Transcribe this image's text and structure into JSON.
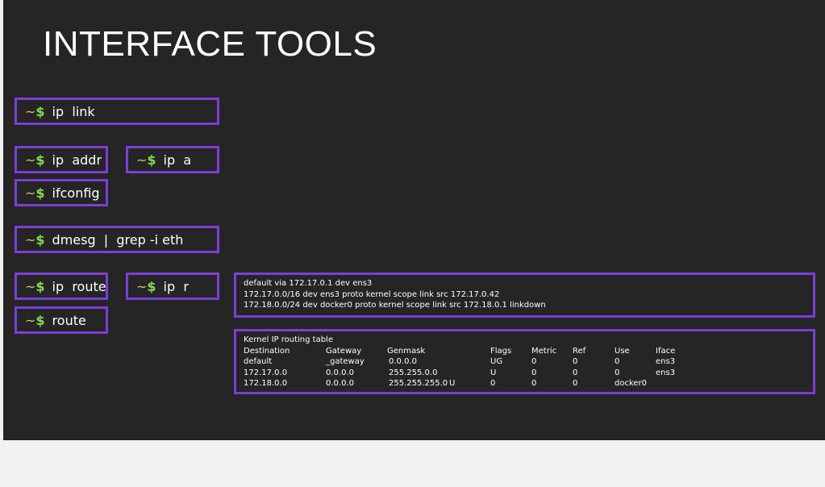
{
  "title": "INTERFACE TOOLS",
  "prompt": {
    "tilde": "~",
    "dollar": "$"
  },
  "commands": {
    "ip_link": "ip  link",
    "ip_addr": "ip  addr",
    "ip_a": "ip  a",
    "ifconfig": "ifconfig",
    "dmesg": "dmesg  |  grep -i eth",
    "ip_route": "ip  route",
    "ip_r": "ip  r",
    "route": "route"
  },
  "ip_route_output": [
    "default via 172.17.0.1 dev ens3",
    "172.17.0.0/16 dev ens3 proto kernel scope link src 172.17.0.42",
    "172.18.0.0/24 dev docker0 proto kernel scope link src 172.18.0.1 linkdown"
  ],
  "route_table": {
    "caption": "Kernel IP routing table",
    "headers": [
      "Destination",
      "Gateway",
      "Genmask",
      "Flags",
      "Metric",
      "Ref",
      "Use",
      "Iface"
    ],
    "rows": [
      [
        "default",
        "_gateway",
        "0.0.0.0",
        "UG",
        "0",
        "0",
        "0",
        "ens3"
      ],
      [
        "172.17.0.0",
        "0.0.0.0",
        "255.255.0.0",
        "U",
        "0",
        "0",
        "0",
        "ens3"
      ],
      [
        "172.18.0.0",
        "0.0.0.0",
        "255.255.255.0",
        "U",
        "0",
        "0",
        "0",
        "docker0"
      ]
    ]
  }
}
